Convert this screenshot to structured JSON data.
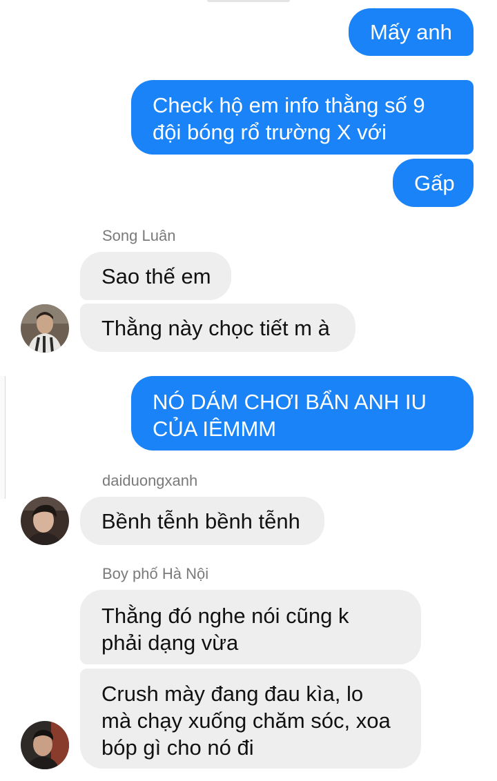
{
  "colors": {
    "outgoing_bubble": "#1a83f7",
    "incoming_bubble": "#eeeeee",
    "sender_name": "#7a7a7a"
  },
  "messages": [
    {
      "direction": "outgoing",
      "text": "Mấy anh"
    },
    {
      "direction": "outgoing",
      "text": "Check hộ em info thằng số 9\nđội bóng rổ trường X với"
    },
    {
      "direction": "outgoing",
      "text": "Gấp"
    },
    {
      "direction": "incoming",
      "sender": "Song Luân",
      "text": "Sao thế em"
    },
    {
      "direction": "incoming",
      "text": "Thằng này chọc tiết m à"
    },
    {
      "direction": "outgoing",
      "text": "NÓ DÁM CHƠI BẨN ANH IU\nCỦA IÊMMM"
    },
    {
      "direction": "incoming",
      "sender": "daiduongxanh",
      "text": "Bềnh tễnh bềnh tễnh"
    },
    {
      "direction": "incoming",
      "sender": "Boy phố Hà Nội",
      "text": "Thằng đó nghe nói cũng k\nphải dạng vừa"
    },
    {
      "direction": "incoming",
      "text": "Crush mày đang đau kìa, lo\nmà chạy xuống chăm sóc, xoa\nbóp gì cho nó đi"
    }
  ],
  "avatars": [
    {
      "icon": "avatar-song-luan-icon"
    },
    {
      "icon": "avatar-daiduongxanh-icon"
    },
    {
      "icon": "avatar-boy-pho-ha-noi-icon"
    }
  ]
}
